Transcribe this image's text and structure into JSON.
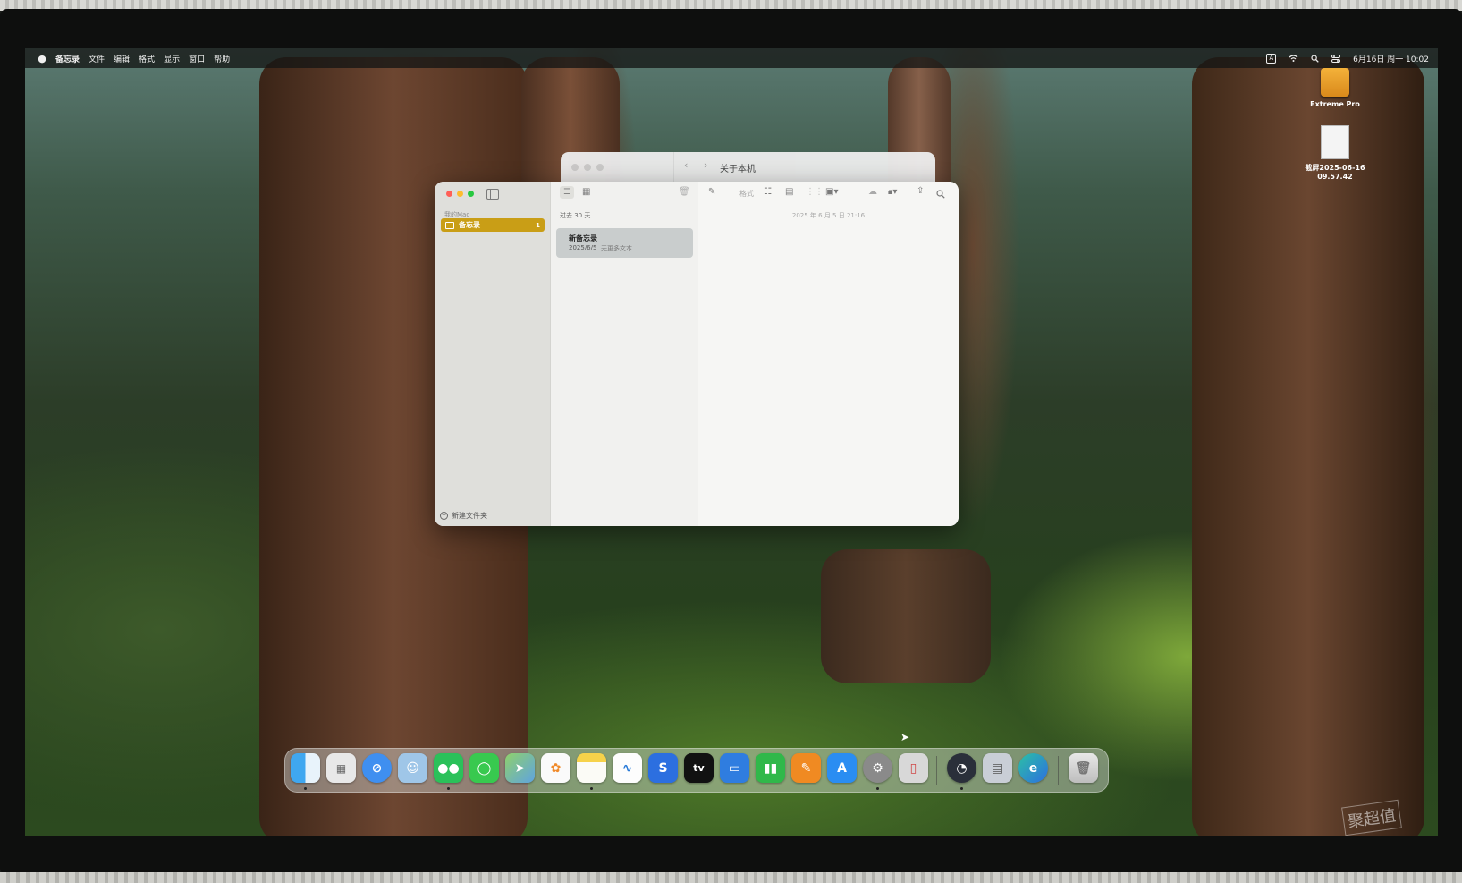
{
  "menubar": {
    "apple_icon": "apple-icon",
    "app_name": "备忘录",
    "items": [
      "文件",
      "编辑",
      "格式",
      "显示",
      "窗口",
      "帮助"
    ],
    "input_badge": "A",
    "clock": "6月16日 周一 10:02"
  },
  "desktop": {
    "drive_label": "Extreme Pro",
    "screenshot_label_line1": "截屏2025-06-16",
    "screenshot_label_line2": "09.57.42"
  },
  "about_window": {
    "title": "关于本机",
    "back_glyph": "‹",
    "forward_glyph": "›"
  },
  "notes_window": {
    "sidebar": {
      "section_label": "我的Mac",
      "folder_label": "备忘录",
      "folder_count": "1",
      "new_folder_label": "新建文件夹"
    },
    "list": {
      "group_label": "过去 30 天",
      "note_title": "新备忘录",
      "note_date": "2025/6/5",
      "note_preview": "无更多文本"
    },
    "editor": {
      "timestamp": "2025 年 6 月 5 日 21:16"
    },
    "toolbar": {
      "format_label": "格式"
    }
  },
  "dock": {
    "apps": [
      "finder",
      "launchpad",
      "safari",
      "avatar-app",
      "wechat",
      "messages",
      "maps",
      "photos",
      "notes",
      "freeform",
      "chatapp",
      "tv",
      "keynote",
      "numbers",
      "pages",
      "app-store",
      "system-settings",
      "iphone-mirroring",
      "istat",
      "disk-utility",
      "edge",
      "trash"
    ],
    "tv_label": "tv"
  },
  "watermark": "聚超值",
  "colors": {
    "folder_accent": "#c99e16",
    "close": "#ff5f57",
    "minimize": "#febc2e",
    "zoom": "#28c840"
  }
}
